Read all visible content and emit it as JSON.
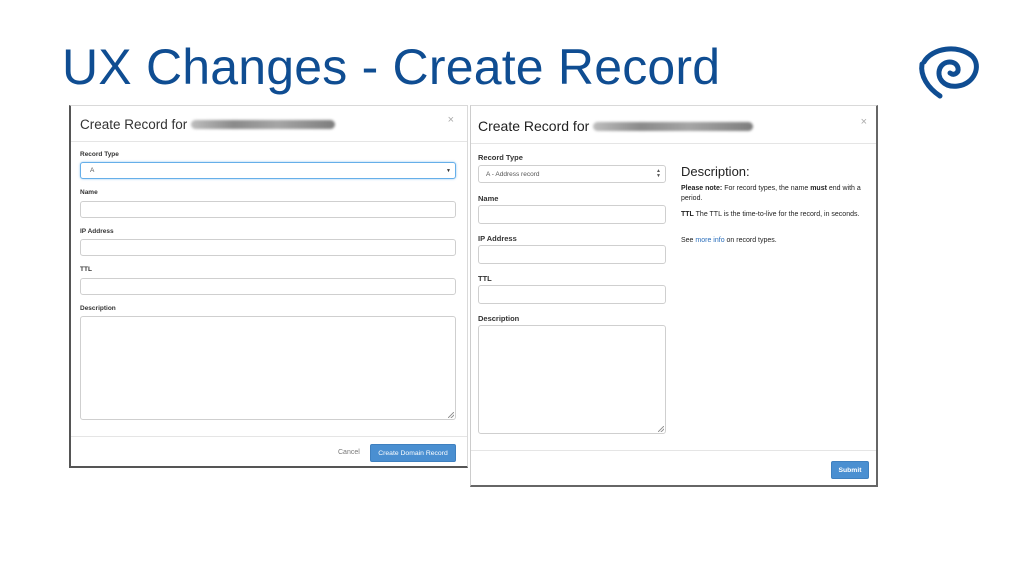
{
  "slide": {
    "title": "UX Changes - Create Record"
  },
  "colors": {
    "title_blue": "#0f4d92",
    "primary": "#4a8fd1",
    "link": "#2a6ebb"
  },
  "old_modal": {
    "title_prefix": "Create Record for",
    "close": "×",
    "record_type_label": "Record Type",
    "record_type_value": "A",
    "name_label": "Name",
    "ip_label": "IP Address",
    "ttl_label": "TTL",
    "description_label": "Description",
    "cancel_label": "Cancel",
    "submit_label": "Create Domain Record"
  },
  "new_modal": {
    "title_prefix": "Create Record for",
    "close": "×",
    "record_type_label": "Record Type",
    "record_type_value": "A - Address record",
    "name_label": "Name",
    "ip_label": "IP Address",
    "ttl_label": "TTL",
    "description_label": "Description",
    "submit_label": "Submit",
    "help": {
      "title": "Description:",
      "note_label": "Please note:",
      "note_text_1": " For record types, the name ",
      "note_must": "must",
      "note_text_2": " end with a period.",
      "ttl_label": "TTL",
      "ttl_text": " The TTL is the time-to-live for the record, in seconds.",
      "see_text": "See ",
      "more_info_link": "more info",
      "see_text_2": " on record types."
    }
  }
}
